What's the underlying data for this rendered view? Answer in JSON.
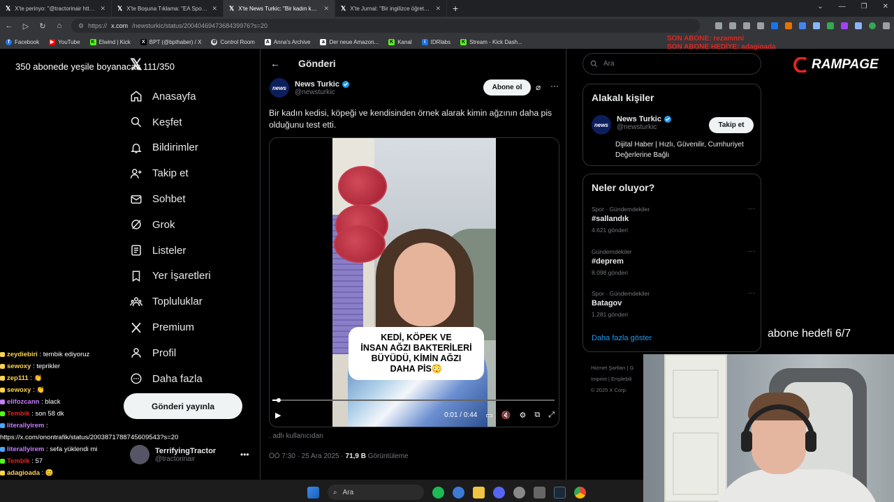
{
  "browser": {
    "tabs": [
      {
        "title": "X'te perinyo: \"@tractorinair http...",
        "active": false
      },
      {
        "title": "X'te Boşuna Tıklama: \"EA Sports...",
        "active": false
      },
      {
        "title": "X'te News Turkic: \"Bir kadın kedi...",
        "active": true
      },
      {
        "title": "X'te Jurnal: \"Bir ingilizce öğretm...",
        "active": false
      }
    ],
    "new_tab": "+",
    "url_prefix": "https://",
    "url_domain": "x.com",
    "url_path": "/newsturkic/status/2004046947368439976?s=20",
    "bookmarks": [
      "Facebook",
      "YouTube",
      "Elwind | Kick",
      "BPT (@bpthaber) / X",
      "Control Room",
      "Anna's Archive",
      "Der neue Amazon...",
      "Kanal",
      "IDRlabs",
      "Stream - Kick Dash..."
    ]
  },
  "overlay": {
    "sub_line1": "SON ABONE: rezamnni",
    "sub_line2": "SON ABONE HEDİYE: adagioada",
    "goal_top": "350 abonede yeşile boyanacak 111/350",
    "goal_right": "abone hedefi 6/7",
    "brand": "RAMPAGE"
  },
  "nav": {
    "items": [
      {
        "label": "Anasayfa",
        "icon": "home-icon"
      },
      {
        "label": "Keşfet",
        "icon": "search-icon"
      },
      {
        "label": "Bildirimler",
        "icon": "bell-icon"
      },
      {
        "label": "Takip et",
        "icon": "follow-icon"
      },
      {
        "label": "Sohbet",
        "icon": "mail-icon"
      },
      {
        "label": "Grok",
        "icon": "grok-icon"
      },
      {
        "label": "Listeler",
        "icon": "list-icon"
      },
      {
        "label": "Yer İşaretleri",
        "icon": "bookmark-icon"
      },
      {
        "label": "Topluluklar",
        "icon": "communities-icon"
      },
      {
        "label": "Premium",
        "icon": "x-logo-icon"
      },
      {
        "label": "Profil",
        "icon": "profile-icon"
      },
      {
        "label": "Daha fazla",
        "icon": "more-circle-icon"
      }
    ],
    "post_button": "Gönderi yayınla",
    "account_name": "TerrifyingTractor",
    "account_handle": "@tractorinair"
  },
  "chat": [
    {
      "user": "zeydiebiri",
      "msg": " : tembik ediyoruz",
      "color": "#ffd34d"
    },
    {
      "user": "sewoxy",
      "msg": " : teprikler",
      "color": "#ffd34d"
    },
    {
      "user": "zep111",
      "msg": " : 👏",
      "color": "#ffd34d"
    },
    {
      "user": "sewoxy",
      "msg": " : 👏",
      "color": "#ffd34d"
    },
    {
      "user": "elifozcann",
      "msg": " : black",
      "color": "#c77dff"
    },
    {
      "user": "Tembik",
      "msg": " : son 58 dk",
      "color": "#e0261f"
    },
    {
      "user": "literallyirem",
      "msg": " :",
      "color": "#c77dff"
    },
    {
      "user": "",
      "msg": "https://x.com/onontrafik/status/2003871788745609543?s=20",
      "color": "#fff"
    },
    {
      "user": "literallyirem",
      "msg": " : sefa yüklendi mi",
      "color": "#c77dff"
    },
    {
      "user": "Tembik",
      "msg": " : 57",
      "color": "#e0261f"
    },
    {
      "user": "adagioada",
      "msg": " : 😊",
      "color": "#ffd34d"
    }
  ],
  "post": {
    "header_title": "Gönderi",
    "author_name": "News Turkic",
    "author_handle": "@newsturkic",
    "avatar_text": "news",
    "follow_label": "Abone ol",
    "text": "Bir kadın kedisi, köpeği ve kendisinden örnek alarak kimin ağzının daha pis olduğunu test etti.",
    "video_caption_1": "KEDİ, KÖPEK VE",
    "video_caption_2": "İNSAN AĞZI BAKTERİLERİ",
    "video_caption_3": "BÜYÜDÜ, KİMİN AĞZI",
    "video_caption_4": "DAHA PİS😳",
    "time_current": "0:01",
    "time_total": "0:44",
    "progress": 0.023,
    "user_tag": "adlı kullanıcıdan",
    "time_posted": "ÖÖ 7:30 · 25 Ara 2025 · ",
    "views": "71,9 B",
    "views_label": " Görüntüleme"
  },
  "right": {
    "search_placeholder": "Ara",
    "related_title": "Alakalı kişiler",
    "related_name": "News Turkic",
    "related_handle": "@newsturkic",
    "related_follow": "Takip et",
    "related_bio": "Dijital Haber | Hızlı, Güvenilir, Cumhuriyet Değerlerine Bağlı",
    "trends_title": "Neler oluyor?",
    "trends": [
      {
        "category": "Spor · Gündemdekiler",
        "name": "#sallandık",
        "count": "4.621 gönderi"
      },
      {
        "category": "Gündemdekiler",
        "name": "#deprem",
        "count": "8.098 gönderi"
      },
      {
        "category": "Spor · Gündemdekiler",
        "name": "Batagov",
        "count": "1.281 gönderi"
      }
    ],
    "show_more": "Daha fazla göster",
    "footer_1": "Hizmet Şartları  |  G",
    "footer_2": "Imprint  |  Erişilebili",
    "footer_3": "© 2025 X Corp."
  },
  "taskbar": {
    "search_label": "Ara"
  }
}
